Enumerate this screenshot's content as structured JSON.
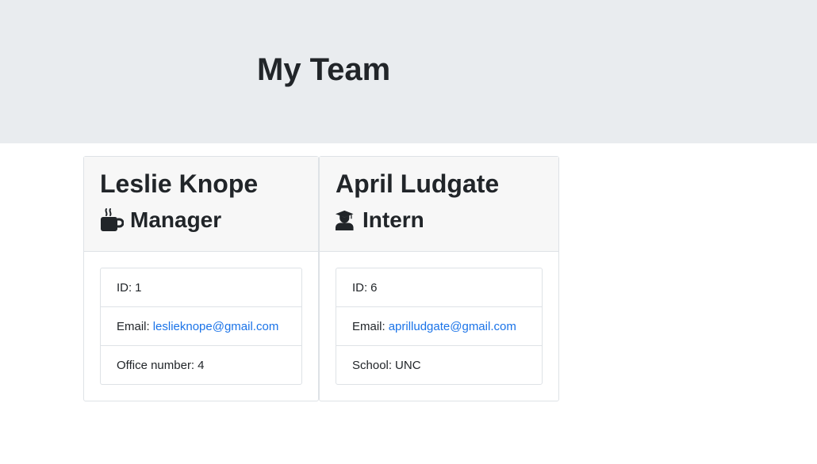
{
  "header": {
    "title": "My Team"
  },
  "colors": {
    "jumbotron_bg": "#e9ecef",
    "link": "#1a73e8",
    "card_header_bg": "#f7f7f7"
  },
  "cards": [
    {
      "name": "Leslie Knope",
      "role": "Manager",
      "role_icon": "coffee-mug-icon",
      "id_label": "ID:",
      "id_value": "1",
      "email_label": "Email:",
      "email_value": "leslieknope@gmail.com",
      "extra_label": "Office number:",
      "extra_value": "4"
    },
    {
      "name": "April Ludgate",
      "role": "Intern",
      "role_icon": "graduate-icon",
      "id_label": "ID:",
      "id_value": "6",
      "email_label": "Email:",
      "email_value": "aprilludgate@gmail.com",
      "extra_label": "School:",
      "extra_value": "UNC"
    }
  ]
}
